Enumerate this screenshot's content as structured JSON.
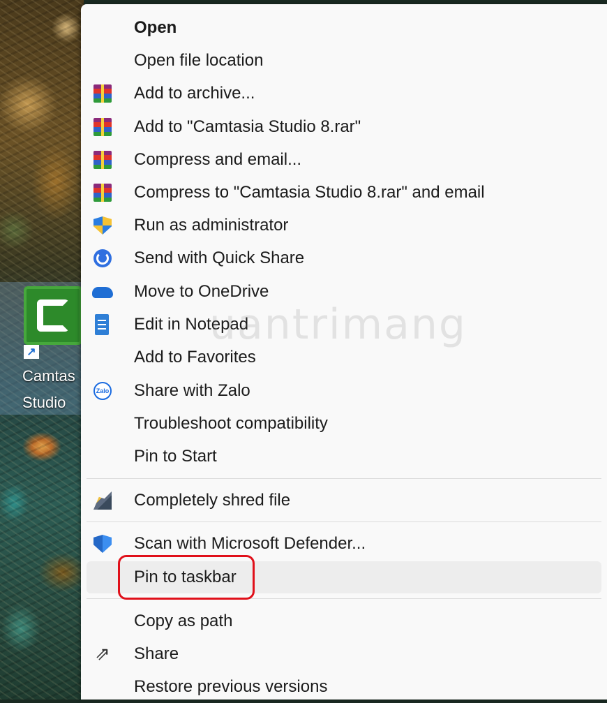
{
  "desktop": {
    "shortcut_label_line1": "Camtas",
    "shortcut_label_line2": "Studio",
    "shortcut_icon": "camtasia-icon"
  },
  "watermark": "uantrimang",
  "context_menu": {
    "items": [
      {
        "label": "Open",
        "icon": "",
        "bold": true
      },
      {
        "label": "Open file location",
        "icon": ""
      },
      {
        "label": "Add to archive...",
        "icon": "winrar-icon"
      },
      {
        "label": "Add to \"Camtasia Studio 8.rar\"",
        "icon": "winrar-icon"
      },
      {
        "label": "Compress and email...",
        "icon": "winrar-icon"
      },
      {
        "label": "Compress to \"Camtasia Studio 8.rar\" and email",
        "icon": "winrar-icon"
      },
      {
        "label": "Run as administrator",
        "icon": "uac-shield-icon"
      },
      {
        "label": "Send with Quick Share",
        "icon": "quick-share-icon"
      },
      {
        "label": "Move to OneDrive",
        "icon": "onedrive-icon"
      },
      {
        "label": "Edit in Notepad",
        "icon": "notepad-icon"
      },
      {
        "label": "Add to Favorites",
        "icon": ""
      },
      {
        "label": "Share with Zalo",
        "icon": "zalo-icon",
        "icon_text": "Zalo"
      },
      {
        "label": "Troubleshoot compatibility",
        "icon": ""
      },
      {
        "label": "Pin to Start",
        "icon": ""
      },
      {
        "label": "Completely shred file",
        "icon": "shred-icon"
      },
      {
        "label": "Scan with Microsoft Defender...",
        "icon": "defender-icon"
      },
      {
        "label": "Pin to taskbar",
        "icon": "",
        "highlighted": true
      },
      {
        "label": "Copy as path",
        "icon": ""
      },
      {
        "label": "Share",
        "icon": "share-icon"
      },
      {
        "label": "Restore previous versions",
        "icon": ""
      }
    ]
  },
  "colors": {
    "menu_background": "#f9f9f9",
    "hover_background": "#ededed",
    "highlight_border": "#e0101a",
    "text": "#1b1b1b"
  }
}
